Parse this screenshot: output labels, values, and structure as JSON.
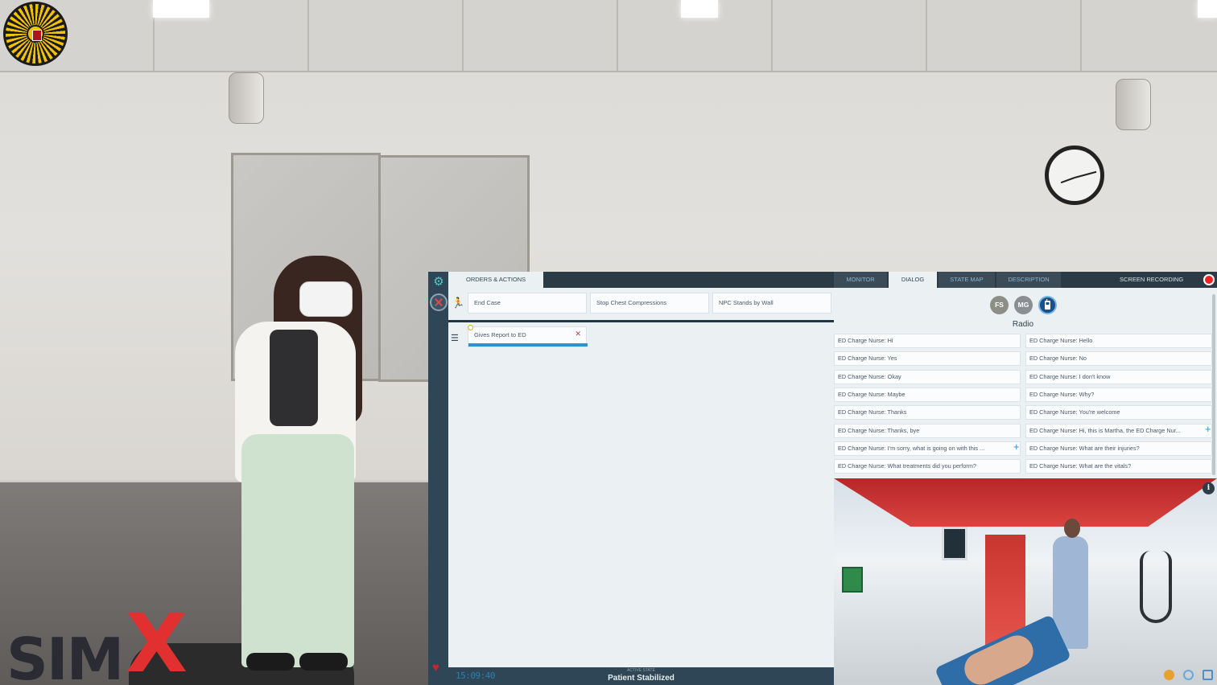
{
  "logos": {
    "simx_prefix": "SIM",
    "simx_x": "X"
  },
  "app": {
    "orders": {
      "tab_label": "ORDERS & ACTIONS",
      "actions": [
        "End Case",
        "Stop Chest Compressions",
        "NPC Stands by Wall"
      ],
      "task": {
        "label": "Gives Report to ED",
        "progress": 1.0
      }
    },
    "status": {
      "timer": "15:09:40",
      "caption": "ACTIVE STATE",
      "state": "Patient Stabilized"
    },
    "right_tabs": [
      {
        "label": "MONITOR",
        "active": false
      },
      {
        "label": "DIALOG",
        "active": true
      },
      {
        "label": "STATE MAP",
        "active": false
      },
      {
        "label": "DESCRIPTION",
        "active": false
      }
    ],
    "screen_recording_label": "SCREEN RECORDING",
    "dialog": {
      "avatars": [
        {
          "initials": "FS",
          "color": "#8d8f87"
        },
        {
          "initials": "MG",
          "color": "#8b8f94"
        },
        {
          "initials": "",
          "icon": "radio-icon",
          "color": "#1f4f86"
        }
      ],
      "title": "Radio",
      "lines_left": [
        "ED Charge Nurse: Hi",
        "ED Charge Nurse: Yes",
        "ED Charge Nurse: Okay",
        "ED Charge Nurse: Maybe",
        "ED Charge Nurse: Thanks",
        "ED Charge Nurse: Thanks, bye",
        "ED Charge Nurse: I'm sorry, what is going on with this ...",
        "ED Charge Nurse: What treatments did you perform?"
      ],
      "lines_right": [
        "ED Charge Nurse: Hello",
        "ED Charge Nurse: No",
        "ED Charge Nurse: I don't know",
        "ED Charge Nurse: Why?",
        "ED Charge Nurse: You're welcome",
        "ED Charge Nurse: Hi, this is Martha, the ED Charge Nur...",
        "ED Charge Nurse: What are their injuries?",
        "ED Charge Nurse: What are the vitals?"
      ]
    }
  },
  "colors": {
    "accent_blue": "#2a93d5",
    "rail": "#2f4656",
    "record_red": "#e22222",
    "brand_red": "#e1302f"
  }
}
